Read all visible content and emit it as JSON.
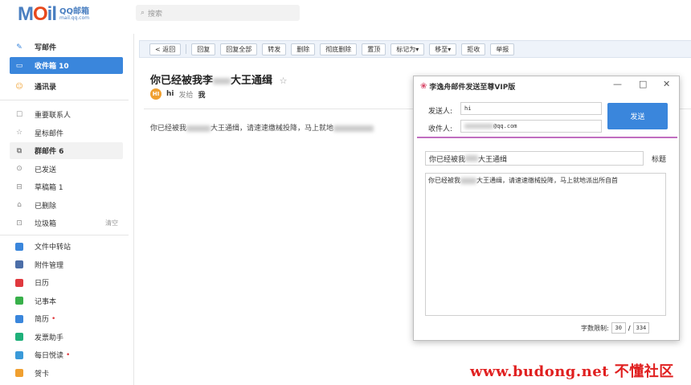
{
  "header": {
    "logo_text_m": "M",
    "logo_text_o": "O",
    "logo_text_il": "il",
    "logo_qq": "QQ邮箱",
    "logo_domain": "mail.qq.com",
    "search_placeholder": "搜索"
  },
  "sidebar": {
    "top_items": [
      {
        "label": "写邮件",
        "icon": "pen-icon"
      },
      {
        "label": "收件箱 10",
        "icon": "inbox-icon"
      },
      {
        "label": "通讯录",
        "icon": "contacts-icon"
      }
    ],
    "folders": [
      {
        "label": "重要联系人"
      },
      {
        "label": "星标邮件"
      },
      {
        "label": "群邮件 6"
      },
      {
        "label": "已发送"
      },
      {
        "label": "草稿箱 1"
      },
      {
        "label": "已删除"
      },
      {
        "label": "垃圾箱",
        "extra": "清空"
      }
    ],
    "apps": [
      {
        "label": "文件中转站",
        "color": "#3a86dc"
      },
      {
        "label": "附件管理",
        "color": "#4c6ea8"
      },
      {
        "label": "日历",
        "color": "#e0393e"
      },
      {
        "label": "记事本",
        "color": "#38b04a"
      },
      {
        "label": "简历",
        "color": "#3a86dc",
        "dot": "•"
      },
      {
        "label": "发票助手",
        "color": "#1fb07a"
      },
      {
        "label": "每日悦读",
        "color": "#3a9ad9",
        "dot": "•"
      },
      {
        "label": "贺卡",
        "color": "#f0a030"
      }
    ]
  },
  "toolbar": {
    "back": "< 返回",
    "buttons": [
      "回复",
      "回复全部",
      "转发",
      "删除",
      "彻底删除",
      "置顶",
      "标记为▾",
      "移至▾",
      "拒收",
      "举报"
    ]
  },
  "mail": {
    "subject_a": "你已经被我李",
    "subject_b": "大王通缉",
    "sender_initial": "HI",
    "sender_name": "hi",
    "to_label": "发给",
    "recipient": "我",
    "body_a": "你已经被我",
    "body_b": "大王通缉，请速速缴械投降，马上就地"
  },
  "popup": {
    "title": "李逸舟邮件发送至尊VIP版",
    "minimize": "—",
    "maximize": "□",
    "close": "✕",
    "from_label": "发送人:",
    "from_value": "hi",
    "to_label": "收件人:",
    "to_value": "@qq.com",
    "send": "发送",
    "subject_value_a": "你已经被我",
    "subject_value_b": "大王通缉",
    "subject_label": "标题",
    "body_a": "你已经被我",
    "body_b": "大王通缉，请速速缴械投降，马上就地派出所自首",
    "limit_label": "字数限制:",
    "limit_count": "30",
    "limit_sep": "/",
    "limit_max": "334"
  },
  "watermark": "www.budong.net 不懂社区"
}
